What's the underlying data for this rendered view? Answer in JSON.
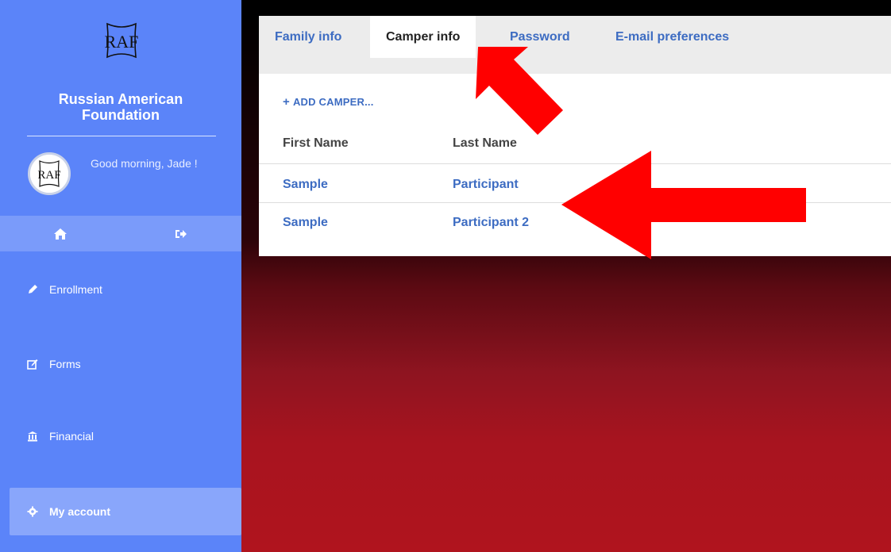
{
  "sidebar": {
    "org_name": "Russian American Foundation",
    "logo_text": "RAF",
    "greeting": "Good morning, Jade !",
    "quick_icons": [
      "home-icon",
      "sign-out-icon"
    ],
    "nav": [
      {
        "label": "Enrollment",
        "icon": "pencil-icon"
      },
      {
        "label": "Forms",
        "icon": "edit-icon"
      },
      {
        "label": "Financial",
        "icon": "bank-icon"
      },
      {
        "label": "My account",
        "icon": "gear-icon",
        "active": true
      }
    ]
  },
  "tabs": [
    {
      "label": "Family info"
    },
    {
      "label": "Camper info",
      "active": true
    },
    {
      "label": "Password"
    },
    {
      "label": "E-mail preferences"
    }
  ],
  "campers": {
    "add_label": "ADD CAMPER...",
    "columns": [
      "First Name",
      "Last Name"
    ],
    "rows": [
      {
        "first": "Sample",
        "last": "Participant"
      },
      {
        "first": "Sample",
        "last": "Participant 2"
      }
    ]
  },
  "colors": {
    "sidebar": "#5b84f9",
    "link": "#3d6cc2",
    "annotation_arrow": "#ff0000",
    "background_red": "#b0141e"
  }
}
